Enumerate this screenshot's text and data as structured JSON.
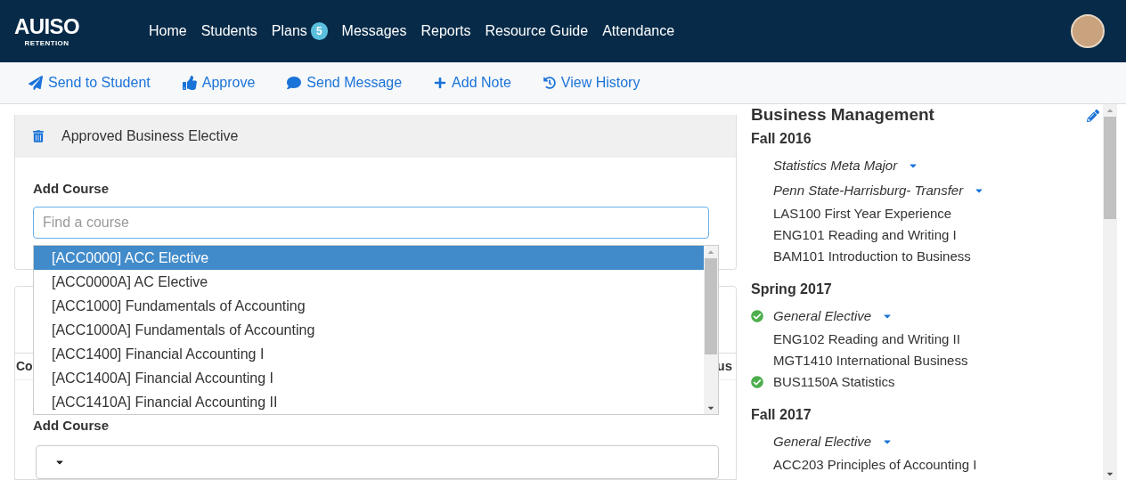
{
  "logo": {
    "title": "AUISO",
    "subtitle": "RETENTION"
  },
  "nav": [
    {
      "label": "Home"
    },
    {
      "label": "Students"
    },
    {
      "label": "Plans",
      "badge": "5"
    },
    {
      "label": "Messages"
    },
    {
      "label": "Reports"
    },
    {
      "label": "Resource Guide"
    },
    {
      "label": "Attendance"
    }
  ],
  "toolbar": [
    {
      "kind": "send",
      "label": "Send to Student"
    },
    {
      "kind": "approve",
      "label": "Approve"
    },
    {
      "kind": "message",
      "label": "Send Message"
    },
    {
      "kind": "add",
      "label": "Add Note"
    },
    {
      "kind": "history",
      "label": "View History"
    }
  ],
  "plan_card": {
    "row": "Approved Business Elective",
    "add_label": "Add Course",
    "search": {
      "placeholder": "Find a course"
    },
    "options": [
      {
        "label": "[ACC0000] ACC Elective",
        "selected": true
      },
      {
        "label": "[ACC0000A] AC Elective",
        "selected": false
      },
      {
        "label": "[ACC1000] Fundamentals of Accounting",
        "selected": false
      },
      {
        "label": "[ACC1000A] Fundamentals of Accounting",
        "selected": false
      },
      {
        "label": "[ACC1400] Financial Accounting I",
        "selected": false
      },
      {
        "label": "[ACC1400A] Financial Accounting I",
        "selected": false
      },
      {
        "label": "[ACC1410A] Financial Accounting II",
        "selected": false
      }
    ]
  },
  "second_card": {
    "column_1": "Co",
    "column_2": "us",
    "add_label": "Add Course"
  },
  "sidebar": {
    "title": "Business Management",
    "terms": [
      {
        "name": "Fall 2016",
        "items": [
          {
            "kind": "group",
            "label": "Statistics Meta Major",
            "completed": false
          },
          {
            "kind": "group",
            "label": "Penn State-Harrisburg- Transfer",
            "completed": false
          },
          {
            "kind": "course",
            "label": "LAS100 First Year Experience",
            "completed": false
          },
          {
            "kind": "course",
            "label": "ENG101 Reading and Writing I",
            "completed": false
          },
          {
            "kind": "course",
            "label": "BAM101 Introduction to Business",
            "completed": false
          }
        ]
      },
      {
        "name": "Spring 2017",
        "items": [
          {
            "kind": "group",
            "label": "General Elective",
            "completed": true
          },
          {
            "kind": "course",
            "label": "ENG102 Reading and Writing II",
            "completed": false
          },
          {
            "kind": "course",
            "label": "MGT1410 International Business",
            "completed": false
          },
          {
            "kind": "course",
            "label": "BUS1150A Statistics",
            "completed": true
          }
        ]
      },
      {
        "name": "Fall 2017",
        "items": [
          {
            "kind": "group",
            "label": "General Elective",
            "completed": false
          },
          {
            "kind": "course",
            "label": "ACC203 Principles of Accounting I",
            "completed": false
          }
        ]
      }
    ]
  }
}
